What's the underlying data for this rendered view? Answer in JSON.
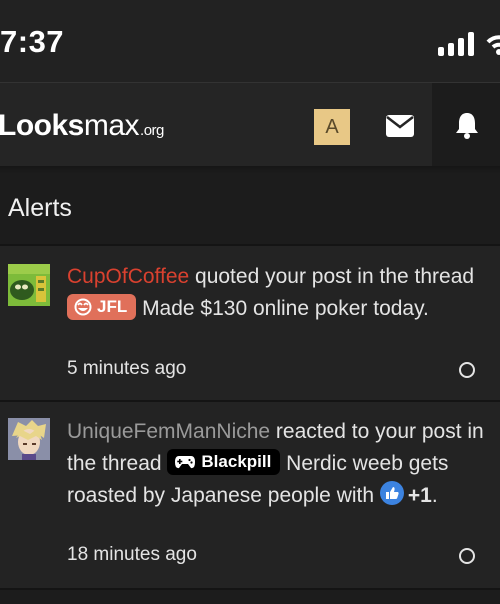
{
  "status_bar": {
    "time": "7:37"
  },
  "header": {
    "logo_main": "Looks",
    "logo_max": "max",
    "logo_tld": ".org",
    "avatar_letter": "A",
    "icons": [
      "envelope-icon",
      "bell-icon"
    ],
    "colors": {
      "avatar_bg": "#e8c886",
      "header_bg": "#252525"
    }
  },
  "alerts": {
    "title": "Alerts",
    "items": [
      {
        "username": "CupOfCoffee",
        "action": " quoted your post in the thread ",
        "prefix": "JFL",
        "prefix_color": "#e0705a",
        "thread": " Made $130 online poker today.",
        "time": "5 minutes ago"
      },
      {
        "username": "UniqueFemManNiche",
        "action": " reacted to your post in the thread ",
        "prefix": "Blackpill",
        "prefix_color": "#000000",
        "thread": " Nerdic weeb gets roasted by Japanese people with ",
        "reaction_icon": "thumbs-up-icon",
        "reaction_count": "+1",
        "tail": ".",
        "time": "18 minutes ago"
      }
    ]
  },
  "colors": {
    "username_red": "#d9412f",
    "username_gray": "#9a9a9a",
    "background": "#1c1c1c",
    "alert_bg": "#232323"
  }
}
